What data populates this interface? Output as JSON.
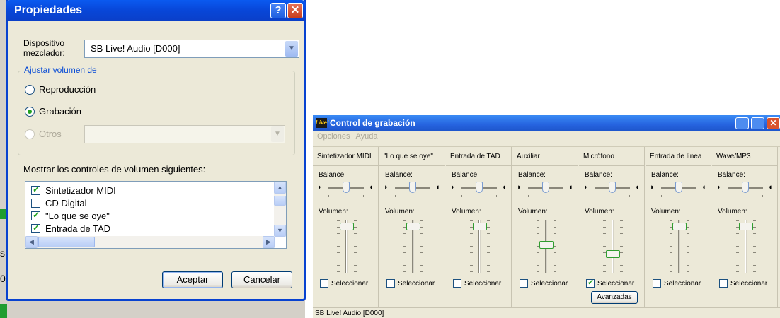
{
  "background": {
    "left_letters": [
      "s",
      "0"
    ]
  },
  "propiedades": {
    "title": "Propiedades",
    "help_label": "?",
    "close_label": "✕",
    "mixer_label_line1": "Dispositivo",
    "mixer_label_line2": "mezclador:",
    "mixer_value": "SB Live! Audio [D000]",
    "group_legend": "Ajustar volumen de",
    "radio_playback": "Reproducción",
    "radio_recording": "Grabación",
    "radio_others": "Otros",
    "selected_radio": "Grabación",
    "show_controls_label": "Mostrar los controles de volumen siguientes:",
    "list_items": [
      {
        "label": "Sintetizador MIDI",
        "checked": true
      },
      {
        "label": "CD Digital",
        "checked": false
      },
      {
        "label": "\"Lo que se oye\"",
        "checked": true
      },
      {
        "label": "Entrada de TAD",
        "checked": true
      }
    ],
    "accept_label": "Aceptar",
    "cancel_label": "Cancelar"
  },
  "recording": {
    "title": "Control de grabación",
    "app_icon_text": "Live!",
    "close_label": "✕",
    "menu": [
      "Opciones",
      "Ayuda"
    ],
    "balance_label": "Balance:",
    "volume_label": "Volumen:",
    "select_label": "Seleccionar",
    "advanced_label": "Avanzadas",
    "status_text": "SB Live! Audio [D000]",
    "channels": [
      {
        "name": "Sintetizador MIDI",
        "selected": false,
        "volume": 0.95
      },
      {
        "name": "\"Lo que se oye\"",
        "selected": false,
        "volume": 0.95
      },
      {
        "name": "Entrada de TAD",
        "selected": false,
        "volume": 0.95
      },
      {
        "name": "Auxiliar",
        "selected": false,
        "volume": 0.55
      },
      {
        "name": "Micrófono",
        "selected": true,
        "volume": 0.35
      },
      {
        "name": "Entrada de línea",
        "selected": false,
        "volume": 0.95
      },
      {
        "name": "Wave/MP3",
        "selected": false,
        "volume": 0.95
      }
    ]
  }
}
